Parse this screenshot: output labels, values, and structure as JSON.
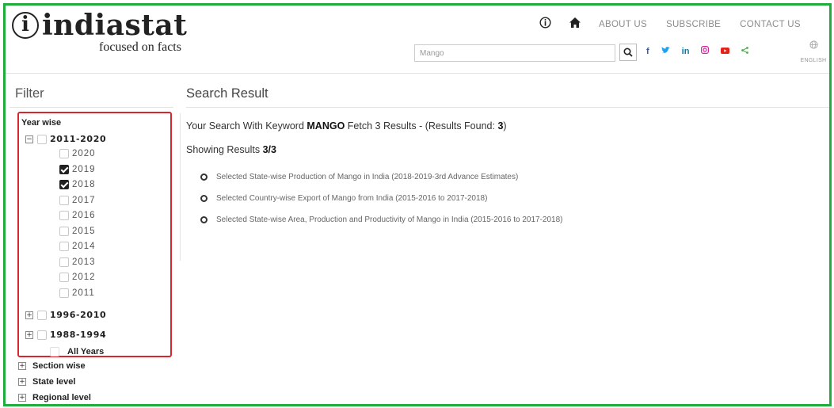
{
  "brand": {
    "mark": "i",
    "name": "indiastat",
    "tagline": "focused on facts"
  },
  "topnav": {
    "links": [
      "ABOUT US",
      "SUBSCRIBE",
      "CONTACT US"
    ]
  },
  "search": {
    "value": "Mango"
  },
  "social_icons": [
    "facebook-icon",
    "twitter-icon",
    "linkedin-icon",
    "instagram-icon",
    "youtube-icon",
    "share-icon"
  ],
  "language": {
    "label": "ENGLISH"
  },
  "colors": {
    "frame_green": "#1fad3e",
    "highlight_red": "#d9262c"
  },
  "filter": {
    "title": "Filter",
    "year_wise_label": "Year wise",
    "group_2011": {
      "label": "2011-2020",
      "years": [
        {
          "year": "2020",
          "checked": false
        },
        {
          "year": "2019",
          "checked": true
        },
        {
          "year": "2018",
          "checked": true
        },
        {
          "year": "2017",
          "checked": false
        },
        {
          "year": "2016",
          "checked": false
        },
        {
          "year": "2015",
          "checked": false
        },
        {
          "year": "2014",
          "checked": false
        },
        {
          "year": "2013",
          "checked": false
        },
        {
          "year": "2012",
          "checked": false
        },
        {
          "year": "2011",
          "checked": false
        }
      ]
    },
    "group_1996": {
      "label": "1996-2010"
    },
    "group_1988": {
      "label": "1988-1994"
    },
    "all_years": "All Years",
    "others": [
      {
        "label": "Section wise"
      },
      {
        "label": "State level"
      },
      {
        "label": "Regional level"
      }
    ]
  },
  "results": {
    "title": "Search Result",
    "summary_prefix": "Your Search With Keyword ",
    "keyword": "MANGO",
    "summary_middle": " Fetch 3 Results - (Results Found: ",
    "found": "3",
    "summary_suffix": ")",
    "showing_label": "Showing Results ",
    "showing_count": "3/3",
    "items": [
      "Selected State-wise Production of Mango in India (2018-2019-3rd Advance Estimates)",
      "Selected Country-wise Export of Mango from India (2015-2016 to 2017-2018)",
      "Selected State-wise Area, Production and Productivity of Mango in India (2015-2016 to 2017-2018)"
    ]
  }
}
